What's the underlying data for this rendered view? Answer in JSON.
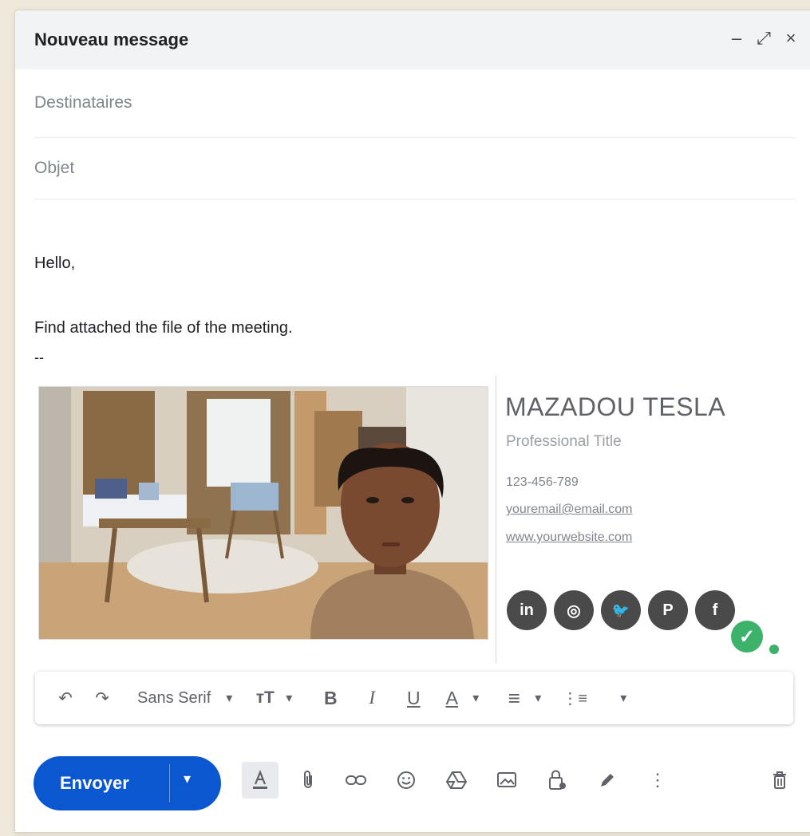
{
  "window": {
    "title": "Nouveau message",
    "controls": {
      "minimize": "–",
      "expand": "⤢",
      "close": "×"
    }
  },
  "fields": {
    "to_placeholder": "Destinataires",
    "subject_placeholder": "Objet"
  },
  "message": {
    "greeting": "Hello,",
    "body": "Find attached the file of the meeting.",
    "separator": "--"
  },
  "signature": {
    "name": "MAZADOU TESLA",
    "title": "Professional Title",
    "phone": "123-456-789",
    "email": "youremail@email.com",
    "website": "www.yourwebsite.com",
    "socials": [
      {
        "icon": "linkedin-icon",
        "glyph": "in"
      },
      {
        "icon": "instagram-icon",
        "glyph": "◎"
      },
      {
        "icon": "twitter-icon",
        "glyph": "🐦"
      },
      {
        "icon": "pinterest-icon",
        "glyph": "P"
      },
      {
        "icon": "facebook-icon",
        "glyph": "f"
      }
    ]
  },
  "toolbar": {
    "font": "Sans Serif",
    "undo": "↶",
    "redo": "↷",
    "size": "ᴛT",
    "bold": "B",
    "italic": "I",
    "underline": "U",
    "color": "A",
    "align": "≡",
    "list": "⋮≡",
    "dropdown": "▾",
    "more": "▾"
  },
  "actions": {
    "send_label": "Envoyer",
    "send_dropdown": "▾",
    "more_options": "⋮"
  },
  "colors": {
    "send_button": "#0b57d0",
    "title_bar": "#f2f3f5",
    "badge": "#3cb26a"
  }
}
